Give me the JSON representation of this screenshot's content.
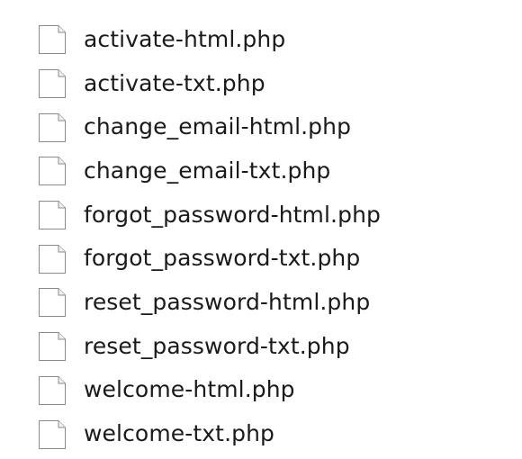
{
  "files": [
    {
      "name": "activate-html.php",
      "icon": "generic-file-icon"
    },
    {
      "name": "activate-txt.php",
      "icon": "generic-file-icon"
    },
    {
      "name": "change_email-html.php",
      "icon": "generic-file-icon"
    },
    {
      "name": "change_email-txt.php",
      "icon": "generic-file-icon"
    },
    {
      "name": "forgot_password-html.php",
      "icon": "generic-file-icon"
    },
    {
      "name": "forgot_password-txt.php",
      "icon": "generic-file-icon"
    },
    {
      "name": "reset_password-html.php",
      "icon": "generic-file-icon"
    },
    {
      "name": "reset_password-txt.php",
      "icon": "generic-file-icon"
    },
    {
      "name": "welcome-html.php",
      "icon": "generic-file-icon"
    },
    {
      "name": "welcome-txt.php",
      "icon": "generic-file-icon"
    }
  ]
}
